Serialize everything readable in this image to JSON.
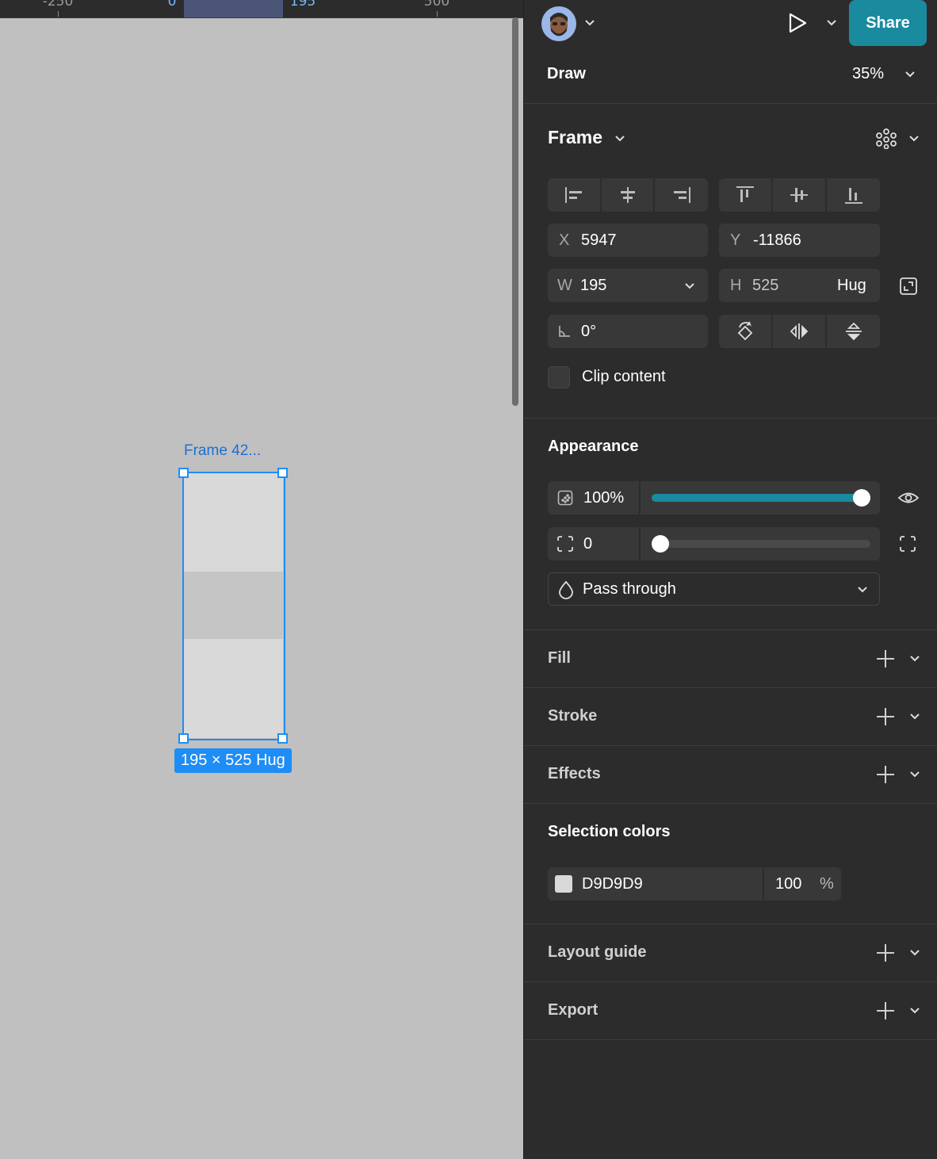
{
  "ruler": {
    "labels": [
      "-250",
      "0",
      "195",
      "500"
    ]
  },
  "canvas": {
    "frame_label": "Frame 42...",
    "size_badge": "195 × 525 Hug",
    "frame_fill": "#d9d9d9",
    "selection_color": "#1e8df5"
  },
  "header": {
    "share_label": "Share",
    "accent": "#1a8a9e"
  },
  "toolbar": {
    "mode_label": "Draw",
    "zoom_label": "35%"
  },
  "frame_section": {
    "title": "Frame",
    "x_label": "X",
    "x_value": "5947",
    "y_label": "Y",
    "y_value": "-11866",
    "w_label": "W",
    "w_value": "195",
    "h_label": "H",
    "h_value": "525",
    "h_mode": "Hug",
    "rotation_value": "0°",
    "clip_label": "Clip content"
  },
  "appearance": {
    "title": "Appearance",
    "opacity_value": "100%",
    "opacity_fraction": 1.0,
    "radius_value": "0",
    "radius_fraction": 0.0,
    "blend_mode": "Pass through"
  },
  "sections": {
    "fill": "Fill",
    "stroke": "Stroke",
    "effects": "Effects",
    "layout_guide": "Layout guide",
    "export": "Export"
  },
  "selection_colors": {
    "title": "Selection colors",
    "hex": "D9D9D9",
    "opacity": "100",
    "percent": "%",
    "swatch": "#d9d9d9"
  }
}
